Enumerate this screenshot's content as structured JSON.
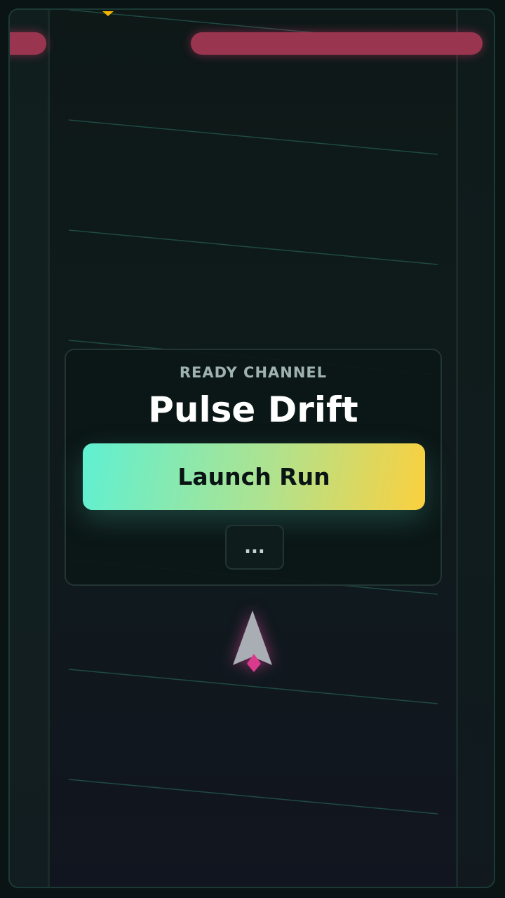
{
  "game": {
    "menu": {
      "eyebrow": "READY CHANNEL",
      "title": "Pulse Drift",
      "primary_action": "Launch Run",
      "more_action": "..."
    },
    "colors": {
      "barrier": "#9a3550",
      "accent_start": "#5ff0d2",
      "accent_end": "#fbd03e",
      "ship": "#a8aeb4",
      "ship_thruster": "#d93a8c",
      "pickup": "#f5b400"
    },
    "icons": {
      "player": "arrow-ship-icon",
      "pickup": "triangle-pickup-icon"
    }
  }
}
